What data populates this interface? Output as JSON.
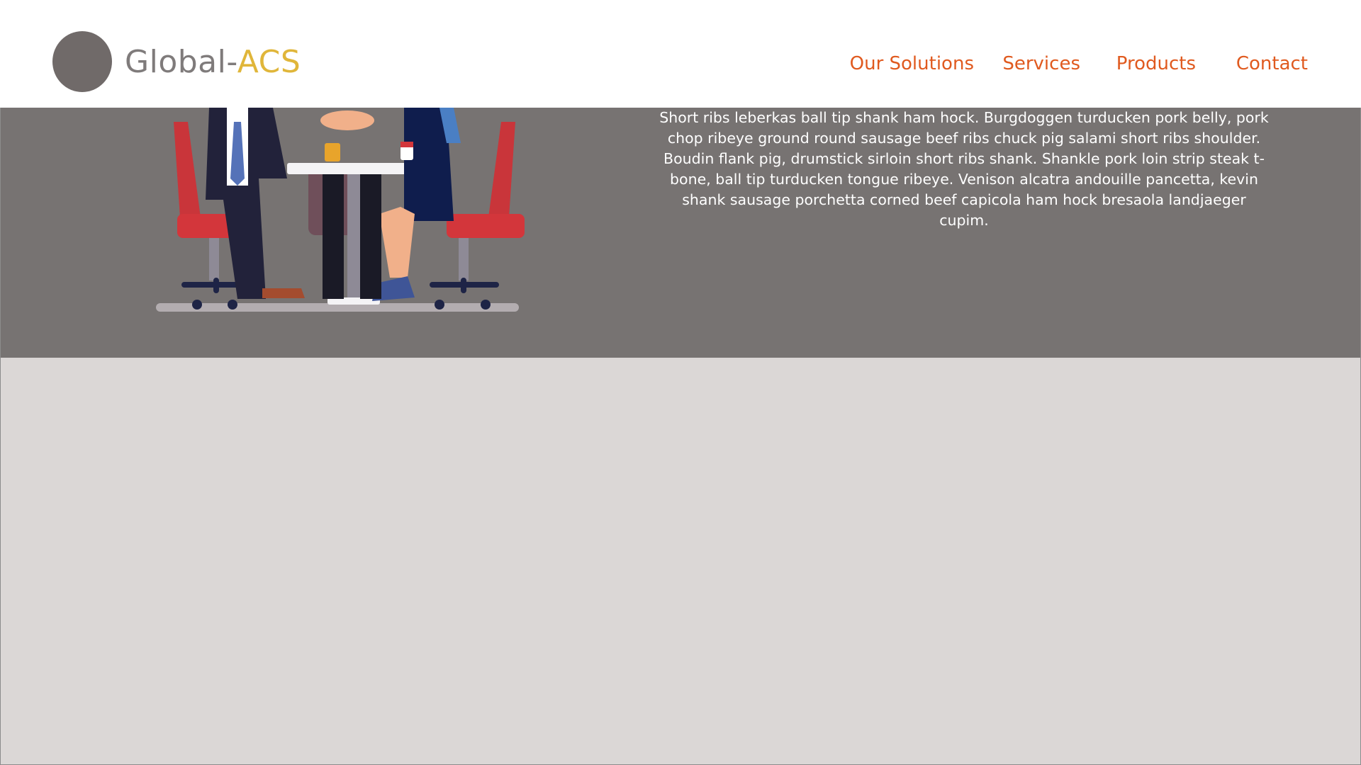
{
  "brand": {
    "name_part1": "Global-",
    "name_part2": "ACS",
    "colors": {
      "name_gray": "#7f7b7b",
      "name_accent": "#e0b63a",
      "nav_link": "#e05a1f",
      "hero_bg": "#777372",
      "page_bg": "#dbd7d6",
      "logo_circle": "#706a69"
    }
  },
  "nav": {
    "items": [
      {
        "label": "Our Solutions"
      },
      {
        "label": "Services"
      },
      {
        "label": "Products"
      },
      {
        "label": "Contact"
      }
    ]
  },
  "hero": {
    "paragraph": "Short ribs leberkas ball tip shank ham hock. Burgdoggen turducken pork belly, pork chop ribeye ground round sausage beef ribs chuck pig salami short ribs shoulder. Boudin flank pig, drumstick sirloin short ribs shank. Shankle pork loin strip steak t-bone, ball tip turducken tongue ribeye. Venison alcatra andouille pancetta, kevin shank sausage porchetta corned beef capicola ham hock bresaola landjaeger cupim.",
    "illustration": "business-meeting-handshake-illustration"
  }
}
